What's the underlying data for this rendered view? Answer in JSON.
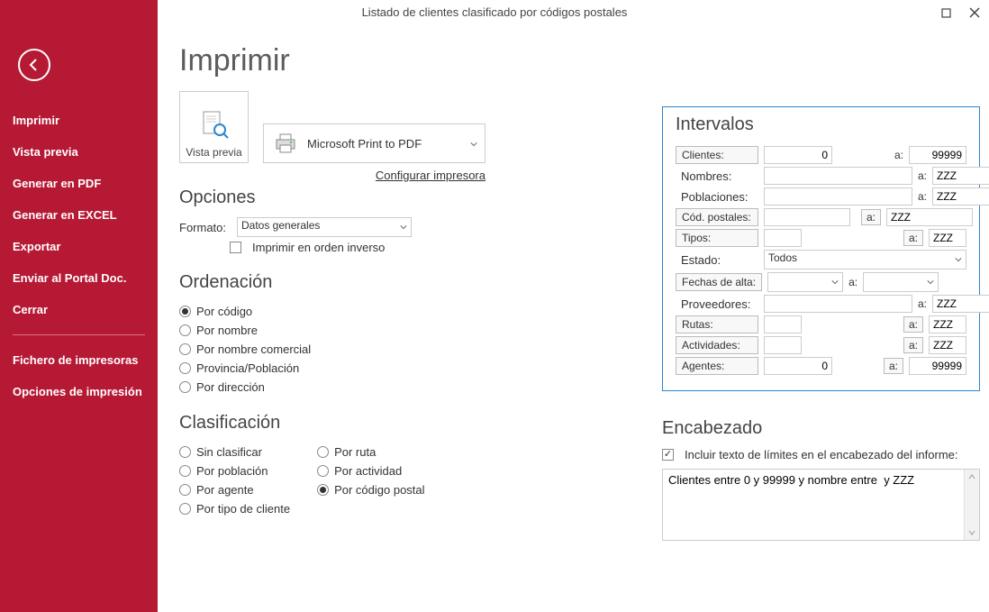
{
  "window": {
    "title": "Listado de clientes clasificado por códigos postales"
  },
  "sidebar": {
    "items": [
      "Imprimir",
      "Vista previa",
      "Generar en PDF",
      "Generar en EXCEL",
      "Exportar",
      "Enviar al Portal Doc.",
      "Cerrar"
    ],
    "footer": [
      "Fichero de impresoras",
      "Opciones de impresión"
    ]
  },
  "page": {
    "title": "Imprimir",
    "preview_label": "Vista previa",
    "printer": "Microsoft Print to PDF",
    "configure_link": "Configurar impresora"
  },
  "opciones": {
    "title": "Opciones",
    "formato_label": "Formato:",
    "formato_value": "Datos generales",
    "reverse_label": "Imprimir en orden inverso",
    "reverse_checked": false
  },
  "ordenacion": {
    "title": "Ordenación",
    "options": [
      "Por código",
      "Por nombre",
      "Por nombre comercial",
      "Provincia/Población",
      "Por dirección"
    ],
    "selected": 0
  },
  "clasificacion": {
    "title": "Clasificación",
    "col1": [
      "Sin clasificar",
      "Por población",
      "Por agente",
      "Por tipo de cliente"
    ],
    "col2": [
      "Por ruta",
      "Por actividad",
      "Por código postal"
    ],
    "selected": "Por código postal"
  },
  "intervalos": {
    "title": "Intervalos",
    "to": "a:",
    "rows": {
      "clientes": {
        "label": "Clientes:",
        "from": "0",
        "to": "99999",
        "button": true,
        "right": true,
        "fromW": 76,
        "toW": 64,
        "gap": true
      },
      "nombres": {
        "label": "Nombres:",
        "from": "",
        "to": "ZZZ",
        "button": false,
        "right": false,
        "fromW": 186,
        "toW": 174
      },
      "poblaciones": {
        "label": "Poblaciones:",
        "from": "",
        "to": "ZZZ",
        "button": false,
        "right": false,
        "fromW": 186,
        "toW": 174
      },
      "codpostales": {
        "label": "Cód. postales:",
        "from": "",
        "to": "ZZZ",
        "button": true,
        "right": false,
        "fromW": 96,
        "toW": 96,
        "gap": true,
        "a_btn": true
      },
      "tipos": {
        "label": "Tipos:",
        "from": "",
        "to": "ZZZ",
        "button": true,
        "right": false,
        "fromW": 42,
        "toW": 42,
        "gap": true,
        "a_btn": true
      },
      "estado": {
        "label": "Estado:",
        "value": "Todos"
      },
      "fechas": {
        "label": "Fechas de alta:"
      },
      "proveedores": {
        "label": "Proveedores:",
        "from": "",
        "to": "ZZZ",
        "button": false,
        "right": false,
        "fromW": 186,
        "toW": 174
      },
      "rutas": {
        "label": "Rutas:",
        "from": "",
        "to": "ZZZ",
        "button": true,
        "right": false,
        "fromW": 42,
        "toW": 42,
        "gap": true,
        "a_btn": true
      },
      "actividades": {
        "label": "Actividades:",
        "from": "",
        "to": "ZZZ",
        "button": true,
        "right": false,
        "fromW": 42,
        "toW": 42,
        "gap": true,
        "a_btn": true
      },
      "agentes": {
        "label": "Agentes:",
        "from": "0",
        "to": "99999",
        "button": true,
        "right": true,
        "fromW": 76,
        "toW": 64,
        "gap": true,
        "a_btn": true
      }
    }
  },
  "encabezado": {
    "title": "Encabezado",
    "checkbox_label": "Incluir texto de límites en el encabezado del informe:",
    "checked": true,
    "text": "Clientes entre 0 y 99999 y nombre entre  y ZZZ"
  }
}
